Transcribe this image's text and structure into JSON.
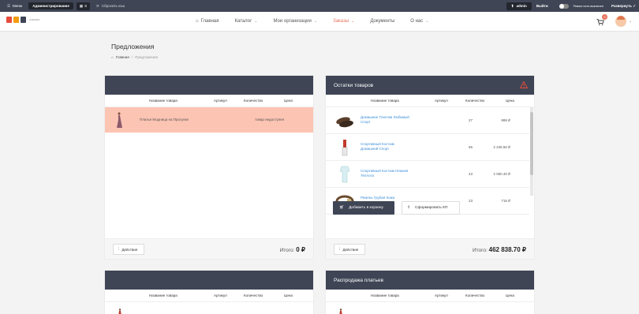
{
  "admin_bar": {
    "menu_label": "Меню",
    "admin_button": "Администрирование",
    "s_button": "S",
    "reset_cache": "Сбросить кэш",
    "user": "admin",
    "logout": "Выйти",
    "mode_label": "Режим гостя",
    "mode_state": "выключен",
    "expand": "Развернуть"
  },
  "logo": {
    "text": "КАБИНЕТ"
  },
  "nav": {
    "items": [
      {
        "label": "Главная"
      },
      {
        "label": "Каталог"
      },
      {
        "label": "Мои организации"
      },
      {
        "label": "Заказы"
      },
      {
        "label": "Документы"
      },
      {
        "label": "О нас"
      }
    ],
    "cart_count": "3"
  },
  "page": {
    "title": "Предложения",
    "breadcrumb": [
      "Главная",
      "/",
      "Предложения"
    ]
  },
  "columns": {
    "name": "Название товара",
    "article": "Артикул",
    "qty": "Количество",
    "price": "Цена"
  },
  "panel1": {
    "title": "",
    "row": {
      "name": "Платье Модница на Прогулке",
      "status": "товар недоступен"
    },
    "actions": "Действия",
    "total_label": "Итого:",
    "total_value": "0 ₽"
  },
  "panel2": {
    "title": "Остатки товаров",
    "rows": [
      {
        "name": "Домашние Тапочки Любимый Спорт",
        "qty": "27",
        "price": "999 ₽"
      },
      {
        "name": "Спортивный Костюм Домашний Спорт",
        "qty": "65",
        "price": "2 235.50 ₽"
      },
      {
        "name": "Спортивный Костюм Нежная Теплота",
        "qty": "43",
        "price": "2 050.40 ₽"
      },
      {
        "name": "Ремень Грубая Кожа",
        "qty": "23",
        "price": "715 ₽"
      }
    ],
    "add_to_cart": "Добавить в корзину",
    "make_kp": "Сформировать КП",
    "actions": "Действия",
    "total_label": "Итого:",
    "total_value": "462 838.70 ₽"
  },
  "panel3": {
    "title": ""
  },
  "panel4": {
    "title": "Распродажа платьев"
  },
  "colors": {
    "header": "#3f4555",
    "accent": "#e8735d",
    "unavailable_row": "#fcc4b3",
    "link": "#3b8fd9"
  }
}
